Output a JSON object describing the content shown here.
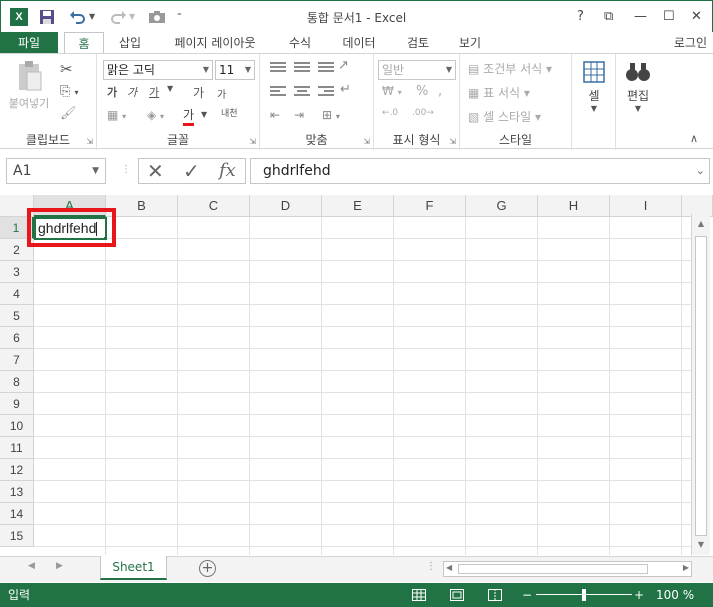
{
  "app": {
    "title": "통합 문서1 - Excel",
    "logo": "X",
    "quick_access": {
      "save_icon": "save-icon",
      "undo_icon": "undo-icon",
      "redo_icon": "redo-icon",
      "camera_icon": "camera-icon",
      "more_icon": "customize-icon"
    },
    "window_buttons": {
      "help": "?",
      "restore_ribbon": "⧉",
      "minimize": "—",
      "maximize": "☐",
      "close": "✕"
    }
  },
  "tabs": [
    "파일",
    "홈",
    "삽입",
    "페이지 레이아웃",
    "수식",
    "데이터",
    "검토",
    "보기"
  ],
  "login": "로그인",
  "ribbon": {
    "clipboard": {
      "paste": "붙여넣기",
      "label": "클립보드"
    },
    "font": {
      "name": "맑은 고딕",
      "size": "11",
      "bold": "가",
      "italic": "가",
      "underline": "가",
      "grow": "가",
      "shrink": "가",
      "color": "가",
      "phonetic": "내천",
      "label": "글꼴"
    },
    "alignment": {
      "label": "맞춤"
    },
    "number": {
      "format": "일반",
      "percent": "%",
      "label": "표시 형식"
    },
    "styles": {
      "conditional": "조건부 서식",
      "table": "표 서식",
      "cell": "셀 스타일",
      "label": "스타일"
    },
    "cells": {
      "label": "셀"
    },
    "editing": {
      "label": "편집"
    }
  },
  "formula_bar": {
    "name_box": "A1",
    "cancel": "✕",
    "enter": "✓",
    "fx": "fx",
    "content": "ghdrlfehd"
  },
  "grid": {
    "columns": [
      "A",
      "B",
      "C",
      "D",
      "E",
      "F",
      "G",
      "H",
      "I"
    ],
    "rows": [
      "1",
      "2",
      "3",
      "4",
      "5",
      "6",
      "7",
      "8",
      "9",
      "10",
      "11",
      "12",
      "13",
      "14",
      "15"
    ],
    "active_cell_value": "ghdrlfehd",
    "selected_column": "A",
    "selected_row": "1"
  },
  "sheets": [
    "Sheet1"
  ],
  "status": {
    "mode": "입력",
    "zoom": "100 %",
    "zoom_minus": "−",
    "zoom_plus": "+"
  },
  "colors": {
    "accent": "#217346",
    "highlight": "#e8161b"
  }
}
